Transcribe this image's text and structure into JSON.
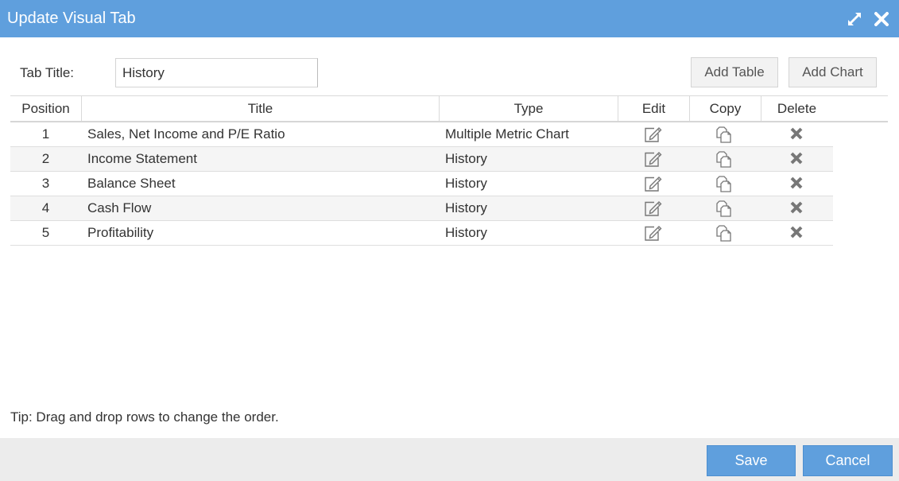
{
  "dialog": {
    "title": "Update Visual Tab",
    "icons": {
      "expand": "expand-arrows-icon",
      "close": "close-x-icon"
    }
  },
  "form": {
    "tab_title_label": "Tab Title:",
    "tab_title_value": "History",
    "add_table_label": "Add Table",
    "add_chart_label": "Add Chart"
  },
  "table": {
    "columns": [
      "Position",
      "Title",
      "Type",
      "Edit",
      "Copy",
      "Delete"
    ],
    "rows": [
      {
        "position": "1",
        "title": "Sales, Net Income and P/E Ratio",
        "type": "Multiple Metric Chart"
      },
      {
        "position": "2",
        "title": "Income Statement",
        "type": "History"
      },
      {
        "position": "3",
        "title": "Balance Sheet",
        "type": "History"
      },
      {
        "position": "4",
        "title": "Cash Flow",
        "type": "History"
      },
      {
        "position": "5",
        "title": "Profitability",
        "type": "History"
      }
    ],
    "row_icons": {
      "edit": "edit-pencil-icon",
      "copy": "copy-pages-icon",
      "delete": "delete-x-icon"
    }
  },
  "tip": "Tip: Drag and drop rows to change the order.",
  "footer": {
    "save_label": "Save",
    "cancel_label": "Cancel"
  },
  "colors": {
    "accent": "#5f9fdd",
    "footer_bg": "#ececec",
    "row_alt_bg": "#f5f5f5",
    "icon_gray": "#777777"
  }
}
